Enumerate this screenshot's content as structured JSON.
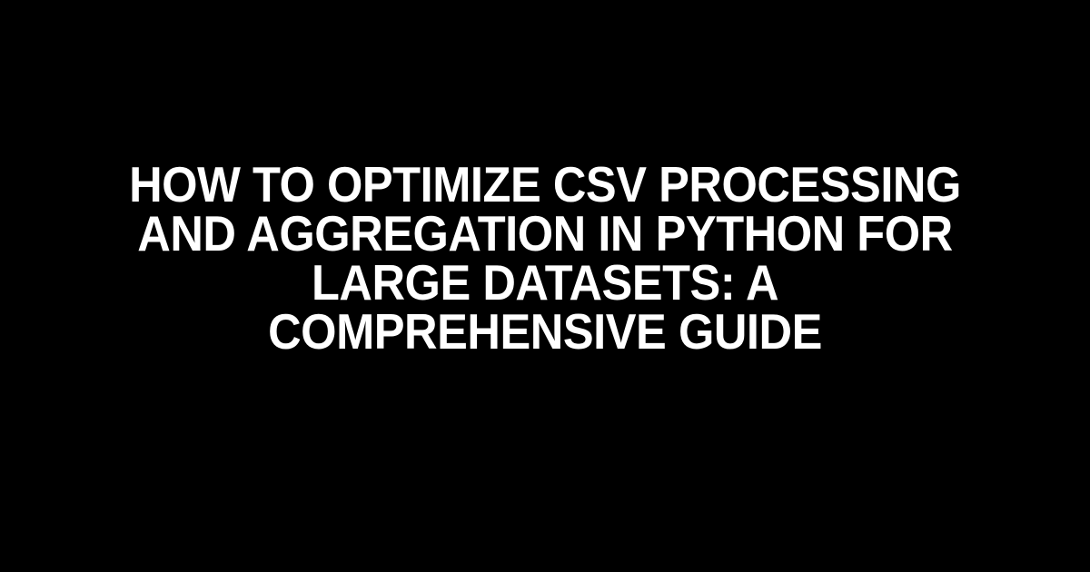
{
  "title": "How to Optimize CSV Processing and Aggregation in Python for Large Datasets: A Comprehensive Guide"
}
